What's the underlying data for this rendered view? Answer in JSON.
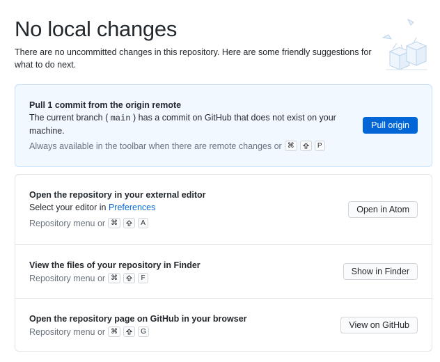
{
  "page": {
    "title": "No local changes",
    "subtitle": "There are no uncommitted changes in this repository. Here are some friendly suggestions for what to do next."
  },
  "primary_action": {
    "heading": "Pull 1 commit from the origin remote",
    "desc_before": "The current branch (",
    "branch": "main",
    "desc_after": ") has a commit on GitHub that does not exist on your machine.",
    "hint": "Always available in the toolbar when there are remote changes or",
    "shortcut_key": "P",
    "button_label": "Pull origin"
  },
  "suggestions": [
    {
      "heading": "Open the repository in your external editor",
      "desc_before": "Select your editor in",
      "desc_link": "Preferences",
      "hint": "Repository menu or",
      "shortcut_key": "A",
      "button_label": "Open in Atom"
    },
    {
      "heading": "View the files of your repository in Finder",
      "hint": "Repository menu or",
      "shortcut_key": "F",
      "button_label": "Show in Finder"
    },
    {
      "heading": "Open the repository page on GitHub in your browser",
      "hint": "Repository menu or",
      "shortcut_key": "G",
      "button_label": "View on GitHub"
    }
  ],
  "colors": {
    "primary_button": "#0366d6",
    "primary_card_bg": "#f1f8ff",
    "link": "#0366d6"
  },
  "icons": {
    "command": "command-icon",
    "shift": "shift-icon",
    "illustration": "empty-boxes-illustration"
  }
}
